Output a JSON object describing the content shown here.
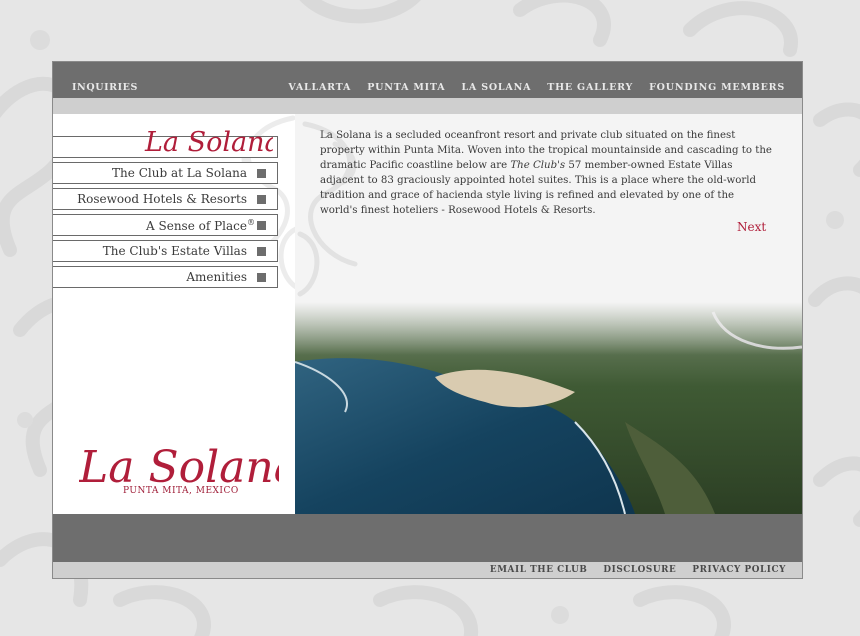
{
  "topnav": {
    "inquiries": "INQUIRIES",
    "links": [
      "VALLARTA",
      "PUNTA MITA",
      "LA SOLANA",
      "THE GALLERY",
      "FOUNDING MEMBERS"
    ]
  },
  "sidebar": {
    "logo_text": "La Solana",
    "items": [
      {
        "label": "The Club at La Solana"
      },
      {
        "label": "Rosewood Hotels & Resorts"
      },
      {
        "label": "A Sense of Place",
        "sup": "®"
      },
      {
        "label": "The Club's Estate Villas"
      },
      {
        "label": "Amenities"
      }
    ],
    "bottom_logo": {
      "name": "La Solana",
      "sub": "PUNTA MITA, MEXICO"
    }
  },
  "main": {
    "para_1": "La Solana is a secluded oceanfront resort and private club situated on the finest property within Punta Mita. Woven into the tropical mountainside and cascading to the dramatic Pacific coastline below are ",
    "para_em": "The Club's",
    "para_2": " 57 member-owned Estate Villas adjacent to 83 graciously appointed hotel suites. This is a place where the old-world tradition and grace of hacienda style living is refined and elevated by one of the world's finest hoteliers - Rosewood Hotels & Resorts.",
    "next": "Next"
  },
  "footer": {
    "links": [
      "EMAIL THE CLUB",
      "DISCLOSURE",
      "PRIVACY POLICY"
    ]
  },
  "colors": {
    "accent": "#b01e3a",
    "nav_bg": "#6e6e6e",
    "bar_bg": "#cfcfcf"
  }
}
